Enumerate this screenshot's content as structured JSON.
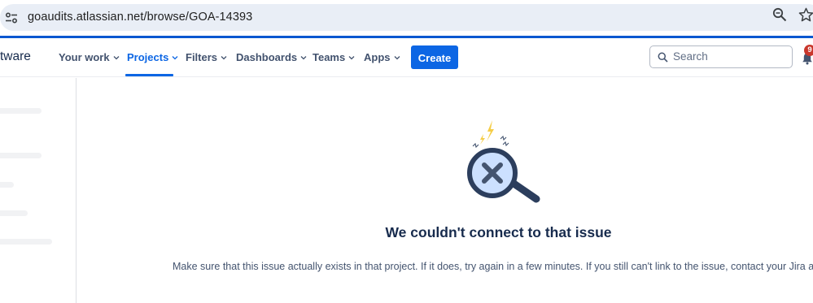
{
  "browser": {
    "url": "goaudits.atlassian.net/browse/GOA-14393",
    "icons": [
      "site-info-icon",
      "zoom-icon",
      "bookmark-star-icon"
    ]
  },
  "topnav": {
    "product_name": "tware",
    "items": [
      {
        "label": "Your work",
        "icon": "chevron-down-icon"
      },
      {
        "label": "Projects",
        "icon": "chevron-down-icon",
        "active": true
      },
      {
        "label": "Filters",
        "icon": "chevron-down-icon"
      },
      {
        "label": "Dashboards",
        "icon": "chevron-down-icon"
      },
      {
        "label": "Teams",
        "icon": "chevron-down-icon"
      },
      {
        "label": "Apps",
        "icon": "chevron-down-icon"
      }
    ],
    "create_label": "Create",
    "search_placeholder": "Search",
    "notifications_count": "9"
  },
  "error": {
    "title": "We couldn't connect to that issue",
    "description": "Make sure that this issue actually exists in that project. If it does, try again in a few minutes. If you still can't link to the issue, contact your Jira adm"
  },
  "colors": {
    "accent": "#0c66e4",
    "browser_accent": "#0b57d0",
    "badge": "#c9372c",
    "title_text": "#172b4d",
    "spark": "#f5cd47"
  }
}
